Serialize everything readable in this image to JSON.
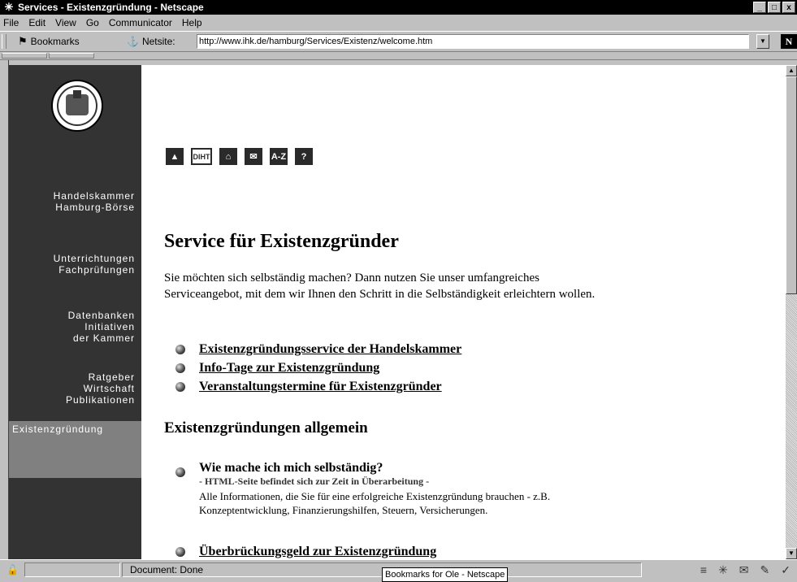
{
  "window": {
    "title": "Services - Existenzgründung - Netscape",
    "controls": [
      "_",
      "□",
      "x"
    ]
  },
  "menubar": {
    "items": [
      "File",
      "Edit",
      "View",
      "Go",
      "Communicator",
      "Help"
    ]
  },
  "locationbar": {
    "bookmarks_label": "Bookmarks",
    "netsite_label": "Netsite:",
    "url": "http://www.ihk.de/hamburg/Services/Existenz/welcome.htm",
    "throbber": "N"
  },
  "sidebar": {
    "items": [
      {
        "label": "Handelskammer\nHamburg-Börse"
      },
      {
        "label": "Unterrichtungen\nFachprüfungen"
      },
      {
        "label": "Datenbanken\nInitiativen\nder Kammer"
      },
      {
        "label": "Ratgeber\nWirtschaft\nPublikationen"
      },
      {
        "label": "Existenzgründung"
      }
    ]
  },
  "navicons": [
    {
      "label": "▲",
      "icon": "top-arrow-icon"
    },
    {
      "label": "DIHT",
      "icon": "diht-icon"
    },
    {
      "label": "⌂",
      "icon": "home-icon"
    },
    {
      "label": "✉",
      "icon": "mail-icon"
    },
    {
      "label": "A-Z",
      "icon": "a-z-index-icon"
    },
    {
      "label": "?",
      "icon": "help-icon"
    }
  ],
  "main": {
    "heading": "Service für Existenzgründer",
    "intro": "Sie möchten sich selbständig machen? Dann nutzen Sie unser umfangreiches Serviceangebot, mit dem wir Ihnen den Schritt in die Selbständigkeit erleichtern wollen.",
    "links": [
      "Existenzgründungsservice der Handelskammer",
      "Info-Tage zur Existenzgründung",
      "Veranstaltungstermine für Existenzgründer"
    ],
    "section_heading": "Existenzgründungen allgemein",
    "item1": {
      "title": "Wie mache ich mich selbständig?",
      "note": "- HTML-Seite befindet sich zur Zeit in Überarbeitung -",
      "desc": "Alle Informationen, die Sie für eine erfolgreiche Existenzgründung brauchen - z.B. Konzeptentwicklung, Finanzierungshilfen, Steuern, Versicherungen."
    },
    "item2": {
      "title": "Überbrückungsgeld zur Existenzgründung"
    }
  },
  "statusbar": {
    "text": "Document: Done",
    "tooltip": "Bookmarks for Ole - Netscape"
  }
}
